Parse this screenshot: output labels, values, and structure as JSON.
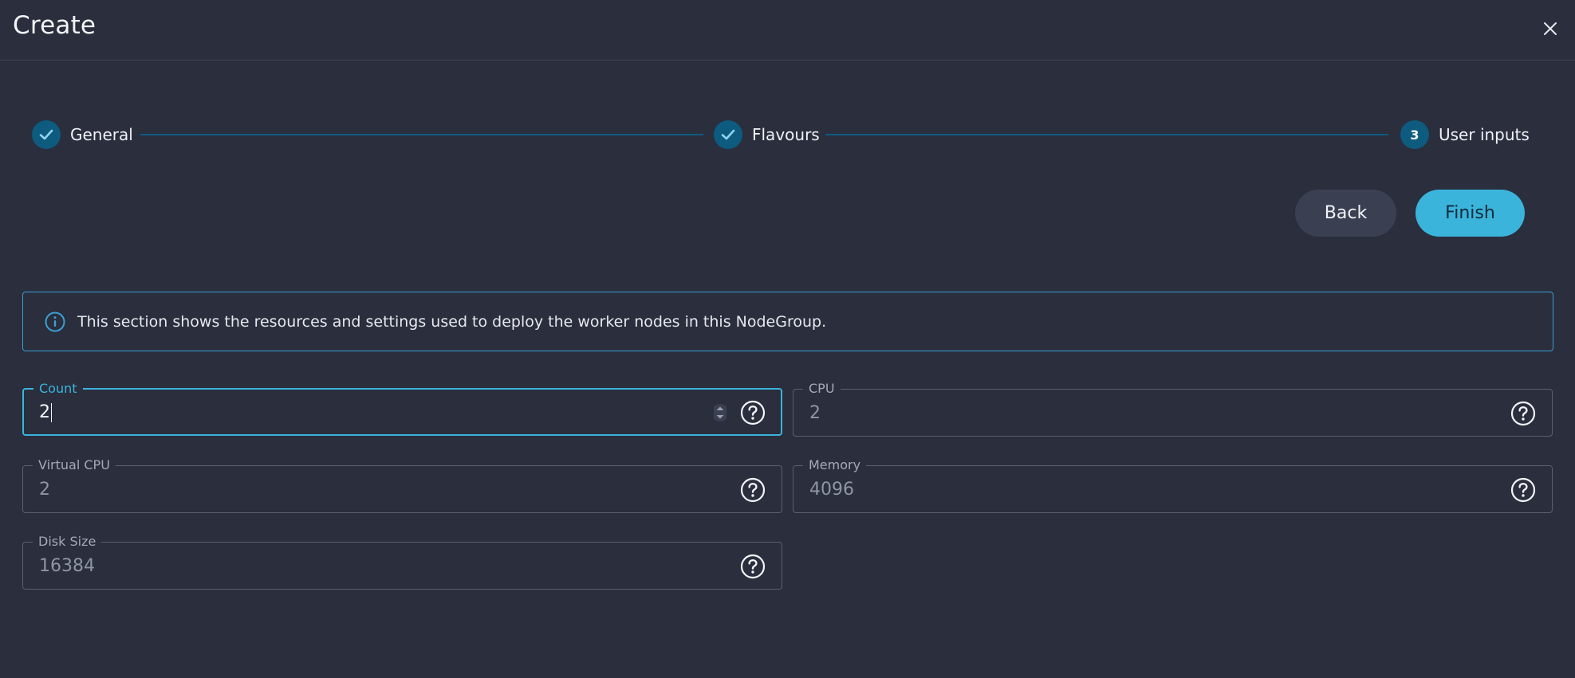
{
  "dialog": {
    "title": "Create"
  },
  "stepper": {
    "steps": [
      {
        "label": "General",
        "state": "completed"
      },
      {
        "label": "Flavours",
        "state": "completed"
      },
      {
        "label": "User inputs",
        "state": "active",
        "number": "3"
      }
    ]
  },
  "actions": {
    "back_label": "Back",
    "finish_label": "Finish"
  },
  "info": {
    "text": "This section shows the resources and settings used to deploy the worker nodes in this NodeGroup."
  },
  "fields": {
    "count": {
      "label": "Count",
      "value": "2"
    },
    "cpu": {
      "label": "CPU",
      "value": "2"
    },
    "virtual_cpu": {
      "label": "Virtual CPU",
      "value": "2"
    },
    "memory": {
      "label": "Memory",
      "value": "4096"
    },
    "disk_size": {
      "label": "Disk Size",
      "value": "16384"
    }
  },
  "colors": {
    "background": "#2a2e3d",
    "accent": "#3bb4dc",
    "step_circle": "#0e5b80",
    "info_border": "#3b9fd4"
  }
}
